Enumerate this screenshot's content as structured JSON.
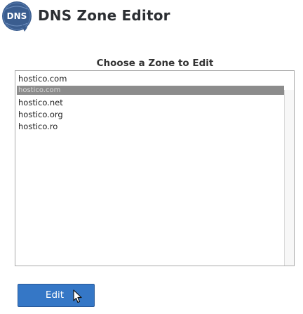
{
  "header": {
    "logo_icon": "dns-globe-icon",
    "logo_text": "DNS",
    "title": "DNS Zone Editor"
  },
  "zone_picker": {
    "label": "Choose a Zone to Edit",
    "input_value": "hostico.com",
    "options": [
      {
        "label": "hostico.com",
        "selected": true
      },
      {
        "label": "hostico.net",
        "selected": false
      },
      {
        "label": "hostico.org",
        "selected": false
      },
      {
        "label": "hostico.ro",
        "selected": false
      }
    ]
  },
  "actions": {
    "edit_label": "Edit"
  },
  "colors": {
    "primary_button": "#3577c6",
    "logo_blue": "#3a5d8f",
    "selection_bg": "#8c8c8c"
  }
}
